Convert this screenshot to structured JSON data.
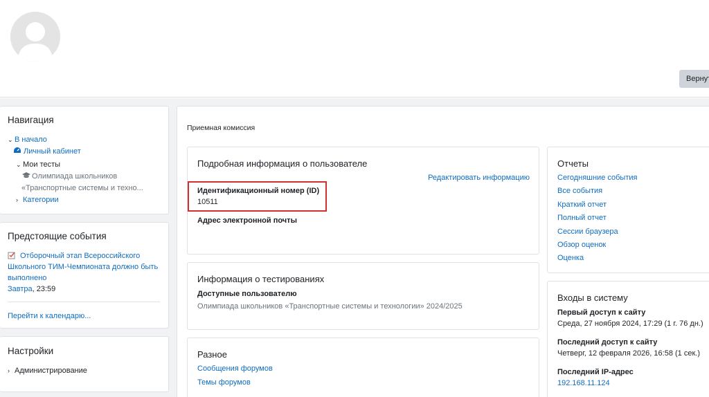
{
  "header": {
    "return_button": "Вернут"
  },
  "navigation": {
    "title": "Навигация",
    "home": "В начало",
    "dashboard": "Личный кабинет",
    "my_courses": "Мои тесты",
    "course_line1": "Олимпиада школьников",
    "course_line2": "«Транспортные системы и техно...",
    "categories": "Категории"
  },
  "events": {
    "title": "Предстоящие события",
    "event_line1": "Отборочный этап Всероссийского",
    "event_line2": "Школьного ТИМ-Чемпионата должно быть",
    "event_line3": "выполнено",
    "event_when_link": "Завтра",
    "event_time": ", 23:59",
    "calendar_link": "Перейти к календарю..."
  },
  "settings": {
    "title": "Настройки",
    "admin": "Администрирование"
  },
  "main": {
    "breadcrumb": "Приемная комиссия",
    "user_details": {
      "title": "Подробная информация о пользователе",
      "edit_link": "Редактировать информацию",
      "id_label": "Идентификационный номер (ID)",
      "id_value": "10511",
      "email_label": "Адрес электронной почты"
    },
    "tests_info": {
      "title": "Информация о тестированиях",
      "available_label": "Доступные пользователю",
      "course": "Олимпиада школьников «Транспортные системы и технологии» 2024/2025"
    },
    "misc": {
      "title": "Разное",
      "forum_posts": "Сообщения форумов",
      "forum_topics": "Темы форумов"
    },
    "reports": {
      "title": "Отчеты",
      "items": [
        "Сегодняшние события",
        "Все события",
        "Краткий отчет",
        "Полный отчет",
        "Сессии браузера",
        "Обзор оценок",
        "Оценка"
      ]
    },
    "logins": {
      "title": "Входы в систему",
      "first_access_label": "Первый доступ к сайту",
      "first_access_value": "Среда, 27 ноября 2024, 17:29  (1 г. 76 дн.)",
      "last_access_label": "Последний доступ к сайту",
      "last_access_value": "Четверг, 12 февраля 2026, 16:58  (1 сек.)",
      "last_ip_label": "Последний IP-адрес",
      "last_ip_value": "192.168.11.124"
    }
  },
  "colors": {
    "link": "#0f6cbf",
    "highlight_border": "#d32f2f",
    "page_bg": "#f1f2f3"
  }
}
